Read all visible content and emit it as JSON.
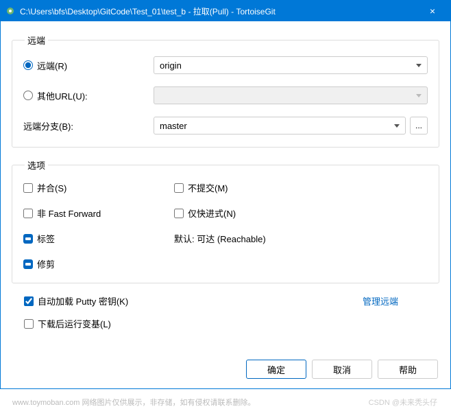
{
  "titlebar": {
    "title": "C:\\Users\\bfs\\Desktop\\GitCode\\Test_01\\test_b - 拉取(Pull) - TortoiseGit",
    "close": "×"
  },
  "remote_group": {
    "legend": "远端",
    "remote_radio_label": "远端(R)",
    "remote_value": "origin",
    "other_url_radio_label": "其他URL(U):",
    "other_url_value": "",
    "branch_label": "远端分支(B):",
    "branch_value": "master",
    "browse_label": "..."
  },
  "options_group": {
    "legend": "选项",
    "merge_label": "并合(S)",
    "no_commit_label": "不提交(M)",
    "no_ff_label": "非 Fast Forward",
    "ff_only_label": "仅快进式(N)",
    "tags_label": "标签",
    "tags_default_text": "默认: 可达 (Reachable)",
    "prune_label": "修剪"
  },
  "misc": {
    "autoload_putty_label": "自动加载 Putty 密钥(K)",
    "manage_remotes_link": "管理远端",
    "rebase_after_label": "下载后运行变基(L)"
  },
  "buttons": {
    "ok": "确定",
    "cancel": "取消",
    "help": "帮助"
  },
  "watermark": {
    "left": "www.toymoban.com  网络图片仅供展示，非存储，如有侵权请联系删除。",
    "right": "CSDN @未来秃头仔"
  }
}
